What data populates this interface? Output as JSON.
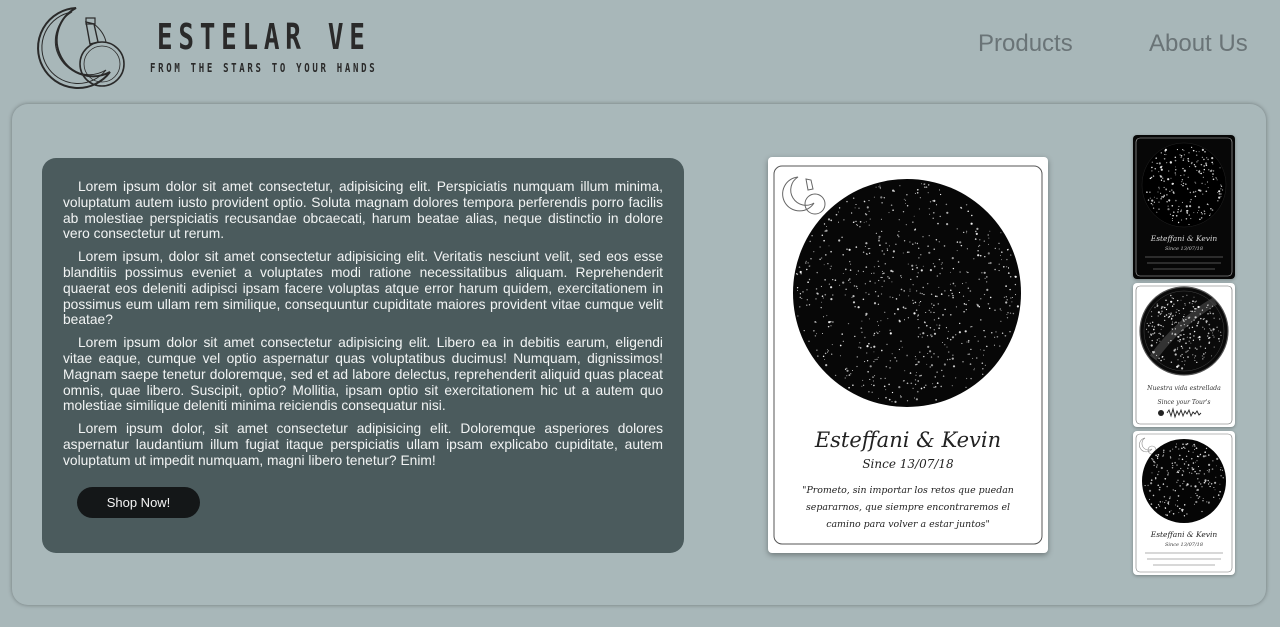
{
  "header": {
    "brand_name": "ESTELAR VE",
    "tagline": "FROM THE STARS TO YOUR HANDS",
    "logo_icon": "moon-bottle-logo"
  },
  "nav": {
    "products": "Products",
    "about": "About Us"
  },
  "content": {
    "paragraphs": [
      "Lorem ipsum dolor sit amet consectetur, adipisicing elit. Perspiciatis numquam illum minima, voluptatum autem iusto provident optio. Soluta magnam dolores tempora perferendis porro facilis ab molestiae perspiciatis recusandae obcaecati, harum beatae alias, neque distinctio in dolore vero consectetur ut rerum.",
      "Lorem ipsum, dolor sit amet consectetur adipisicing elit. Veritatis nesciunt velit, sed eos esse blanditiis possimus eveniet a voluptates modi ratione necessitatibus aliquam. Reprehenderit quaerat eos deleniti adipisci ipsam facere voluptas atque error harum quidem, exercitationem in possimus eum ullam rem similique, consequuntur cupiditate maiores provident vitae cumque velit beatae?",
      "Lorem ipsum dolor sit amet consectetur adipisicing elit. Libero ea in debitis earum, eligendi vitae eaque, cumque vel optio aspernatur quas voluptatibus ducimus! Numquam, dignissimos! Magnam saepe tenetur doloremque, sed et ad labore delectus, reprehenderit aliquid quas placeat omnis, quae libero. Suscipit, optio? Mollitia, ipsam optio sit exercitationem hic ut a autem quo molestiae similique deleniti minima reiciendis consequatur nisi.",
      "Lorem ipsum dolor, sit amet consectetur adipisicing elit. Doloremque asperiores dolores aspernatur laudantium illum fugiat itaque perspiciatis ullam ipsam explicabo cupiditate, autem voluptatum ut impedit numquam, magni libero tenetur? Enim!"
    ],
    "shop_button": "Shop Now!"
  },
  "preview": {
    "names": "Esteffani & Kevin",
    "since": "Since 13/07/18",
    "quote_lines": [
      "\"Prometo, sin importar los retos que puedan",
      "separarnos, que siempre encontraremos el",
      "camino para volver a estar juntos\""
    ]
  },
  "thumbnails": [
    {
      "style": "dark",
      "names": "Esteffani & Kevin",
      "since": "Since 13/07/18"
    },
    {
      "style": "constellation",
      "title": "Nuestra vida estrellada",
      "subtitle": "Since your Tour's"
    },
    {
      "style": "light",
      "names": "Esteffani & Kevin",
      "since": "Since 13/07/18"
    }
  ],
  "colors": {
    "background": "#a8b7b9",
    "text_card": "#4b5b5d",
    "button": "#141718",
    "nav_text": "#6a7477"
  }
}
